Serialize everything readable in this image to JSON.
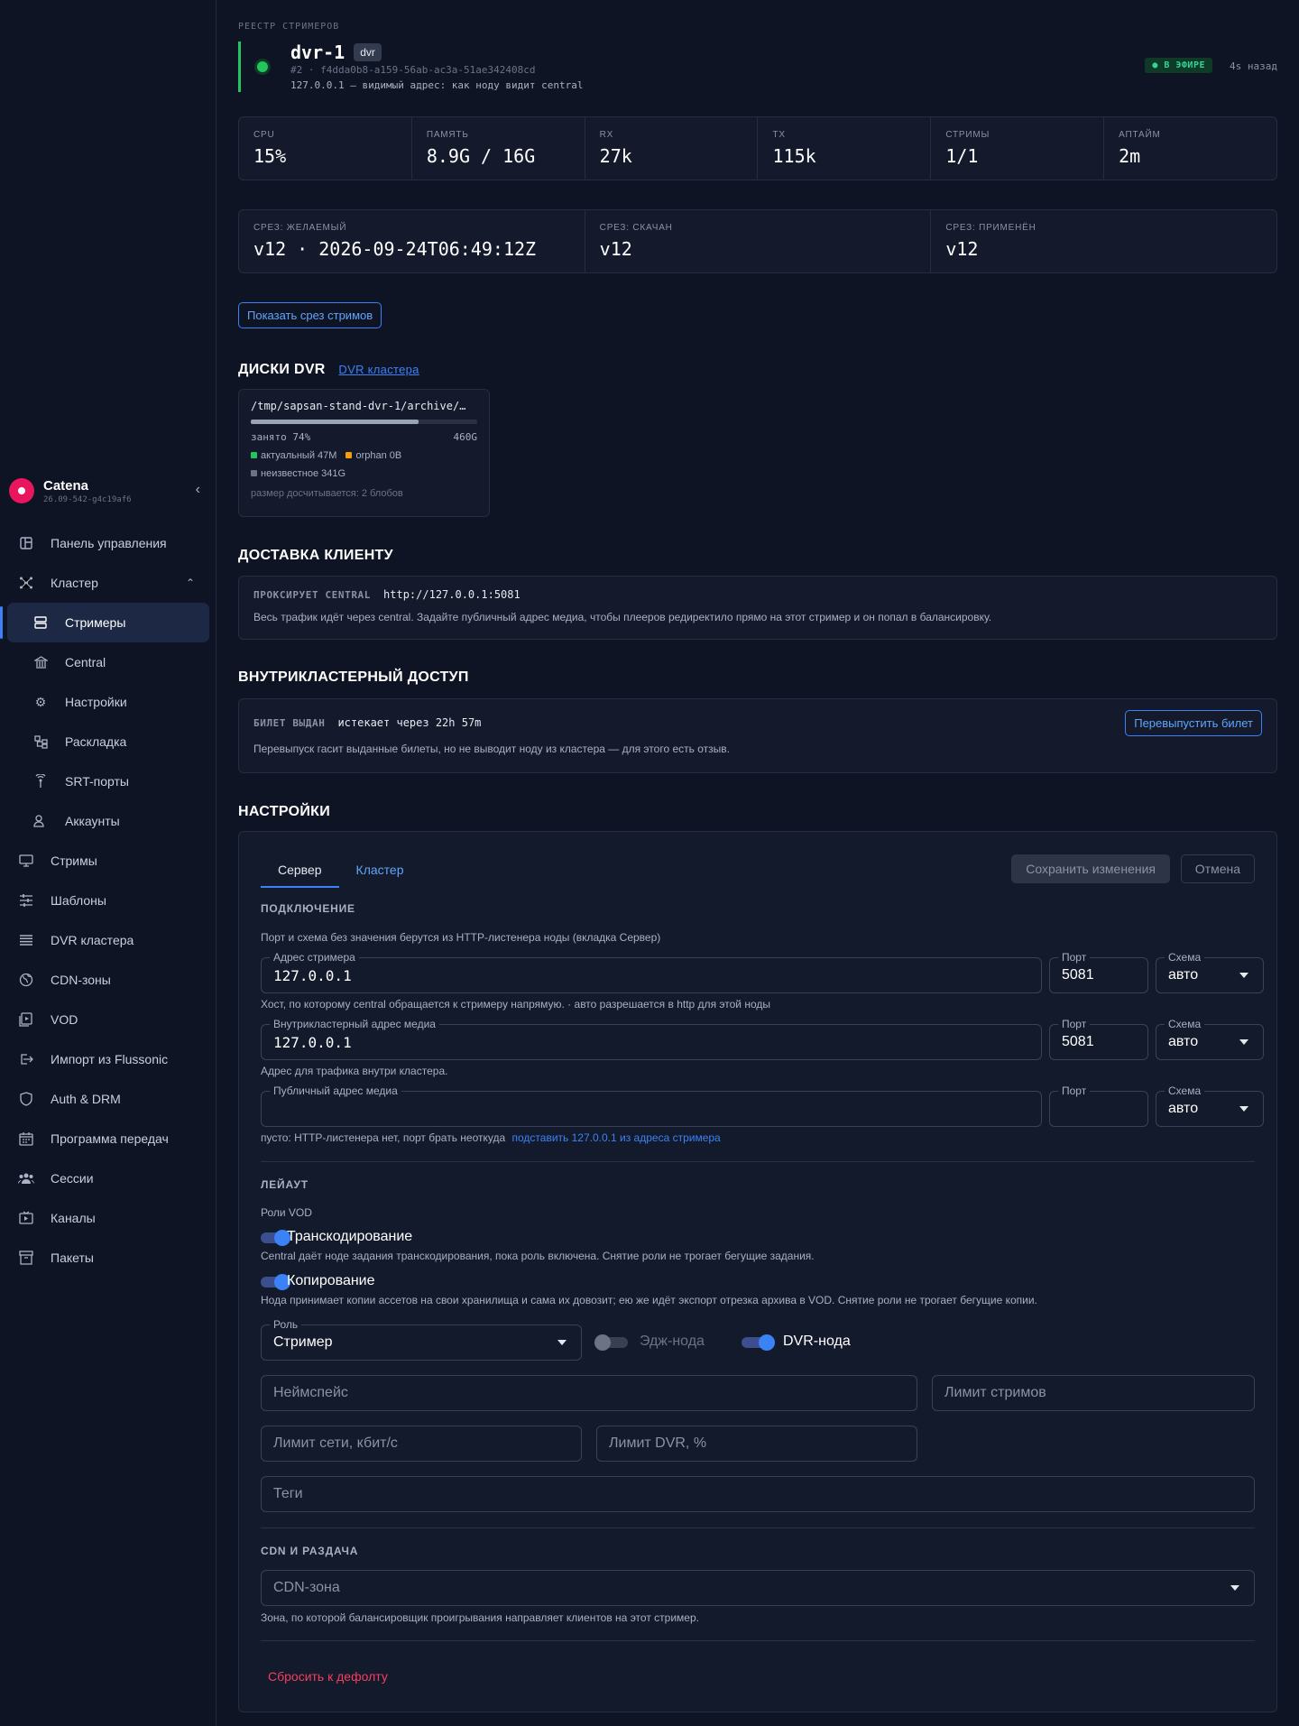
{
  "app": {
    "name": "Catena",
    "version": "26.09-542-g4c19af6"
  },
  "nav": [
    {
      "label": "Панель управления",
      "icon": "dashboard-icon"
    },
    {
      "label": "Кластер",
      "icon": "cluster-icon"
    },
    {
      "label": "Стримеры",
      "icon": "server-icon",
      "active": true
    },
    {
      "label": "Central",
      "icon": "bank-icon"
    },
    {
      "label": "Настройки",
      "icon": "gear-icon"
    },
    {
      "label": "Раскладка",
      "icon": "layout-icon"
    },
    {
      "label": "SRT-порты",
      "icon": "antenna-icon"
    },
    {
      "label": "Аккаунты",
      "icon": "users-icon"
    },
    {
      "label": "Стримы",
      "icon": "monitor-icon"
    },
    {
      "label": "Шаблоны",
      "icon": "sliders-icon"
    },
    {
      "label": "DVR кластера",
      "icon": "list-icon"
    },
    {
      "label": "CDN-зоны",
      "icon": "globe-icon"
    },
    {
      "label": "VOD",
      "icon": "film-icon"
    },
    {
      "label": "Импорт из Flussonic",
      "icon": "import-icon"
    },
    {
      "label": "Auth & DRM",
      "icon": "shield-icon"
    },
    {
      "label": "Программа передач",
      "icon": "calendar-icon"
    },
    {
      "label": "Сессии",
      "icon": "group-icon"
    },
    {
      "label": "Каналы",
      "icon": "tv-icon"
    },
    {
      "label": "Пакеты",
      "icon": "archive-icon"
    }
  ],
  "header": {
    "kicker": "РЕЕСТР СТРИМЕРОВ",
    "name": "dvr-1",
    "tag": "dvr",
    "id": "#2 · f4dda0b8-a159-56ab-ac3a-51ae342408cd",
    "address": "127.0.0.1 — видимый адрес: как ноду видит central",
    "status": "● В ЭФИРЕ",
    "ago": "4s назад",
    "status_color": "#22c55e"
  },
  "stats": [
    {
      "label": "CPU",
      "value": "15%"
    },
    {
      "label": "ПАМЯТЬ",
      "value": "8.9G / 16G"
    },
    {
      "label": "RX",
      "value": "27k"
    },
    {
      "label": "TX",
      "value": "115k"
    },
    {
      "label": "СТРИМЫ",
      "value": "1/1"
    },
    {
      "label": "АПТАЙМ",
      "value": "2m"
    }
  ],
  "slices": [
    {
      "label": "СРЕЗ: ЖЕЛАЕМЫЙ",
      "value": "v12 · 2026-09-24T06:49:12Z"
    },
    {
      "label": "СРЕЗ: СКАЧАН",
      "value": "v12"
    },
    {
      "label": "СРЕЗ: ПРИМЕНЁН",
      "value": "v12"
    }
  ],
  "show_slice_button": "Показать срез стримов",
  "disks": {
    "title": "ДИСКИ DVR",
    "link": "DVR кластера",
    "path": "/tmp/sapsan-stand-dvr-1/archive/…",
    "used_label": "занято 74%",
    "used_fraction": 0.74,
    "total": "460G",
    "actual": "актуальный 47M",
    "orphan": "orphan 0B",
    "unknown": "неизвестное 341G",
    "note": "размер досчитывается: 2 блобов"
  },
  "delivery": {
    "title": "ДОСТАВКА КЛИЕНТУ",
    "tag": "ПРОКСИРУЕТ CENTRAL",
    "url": "http://127.0.0.1:5081",
    "desc": "Весь трафик идёт через central. Задайте публичный адрес медиа, чтобы плееров редиректило прямо на этот стример и он попал в балансировку."
  },
  "access": {
    "title": "ВНУТРИКЛАСТЕРНЫЙ ДОСТУП",
    "tag": "БИЛЕТ ВЫДАН",
    "expires": "истекает через 22h 57m",
    "button": "Перевыпустить билет",
    "desc": "Перевыпуск гасит выданные билеты, но не выводит ноду из кластера — для этого есть отзыв."
  },
  "settings": {
    "title": "НАСТРОЙКИ",
    "tabs": [
      "Сервер",
      "Кластер"
    ],
    "save": "Сохранить изменения",
    "cancel": "Отмена",
    "connection": {
      "title": "ПОДКЛЮЧЕНИЕ",
      "hint": "Порт и схема без значения берутся из HTTP-листенера ноды (вкладка Сервер)",
      "streamer_addr_label": "Адрес стримера",
      "streamer_addr": "127.0.0.1",
      "port_label": "Порт",
      "port1": "5081",
      "scheme_label": "Схема",
      "scheme": "авто",
      "streamer_hint": "Хост, по которому central обращается к стримеру напрямую. · авто разрешается в http для этой ноды",
      "internal_label": "Внутрикластерный адрес медиа",
      "internal_addr": "127.0.0.1",
      "port2": "5081",
      "internal_hint": "Адрес для трафика внутри кластера.",
      "public_label": "Публичный адрес медиа",
      "public_hint": "пусто: HTTP-листенера нет, порт брать неоткуда",
      "public_link": "подставить 127.0.0.1 из адреса стримера"
    },
    "layout": {
      "title": "ЛЕЙАУТ",
      "roles_label": "Роли VOD",
      "transcode": "Транскодирование",
      "transcode_desc": "Central даёт ноде задания транскодирования, пока роль включена. Снятие роли не трогает бегущие задания.",
      "copy": "Копирование",
      "copy_desc": "Нода принимает копии ассетов на свои хранилища и сама их довозит; ею же идёт экспорт отрезка архива в VOD. Снятие роли не трогает бегущие копии.",
      "role_label": "Роль",
      "role": "Стример",
      "edge": "Эдж-нода",
      "dvr": "DVR-нода",
      "namespace": "Неймспейс",
      "stream_limit": "Лимит стримов",
      "net_limit": "Лимит сети, кбит/с",
      "dvr_limit": "Лимит DVR, %",
      "tags": "Теги"
    },
    "cdn": {
      "title": "CDN И РАЗДАЧА",
      "zone": "CDN-зона",
      "hint": "Зона, по которой балансировщик проигрывания направляет клиентов на этот стример."
    },
    "reset": "Сбросить к дефолту"
  }
}
